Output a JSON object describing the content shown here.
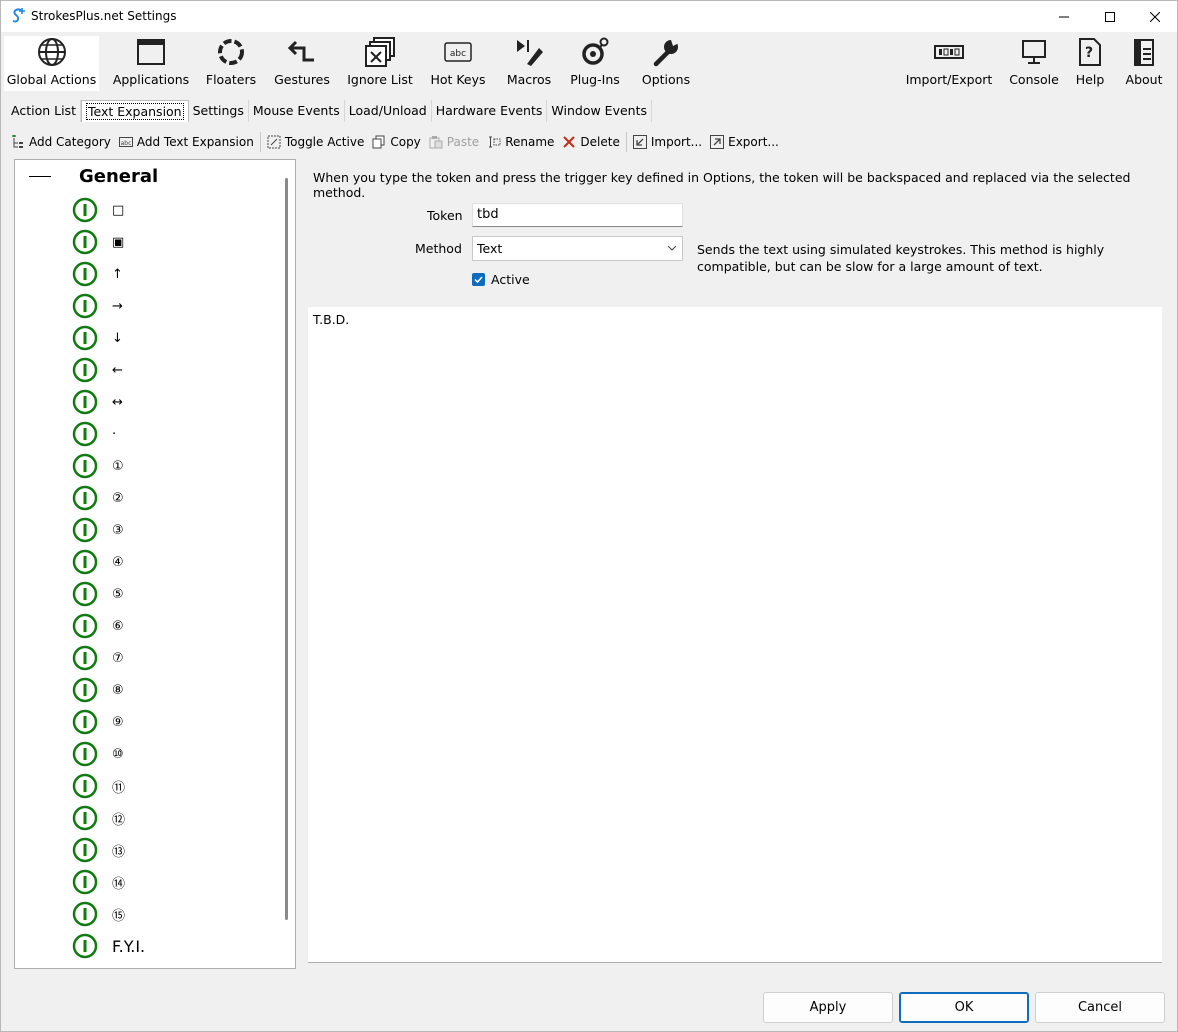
{
  "window": {
    "title": "StrokesPlus.net Settings"
  },
  "ribbon": {
    "items": [
      {
        "label": "Global Actions",
        "icon": "globe-icon"
      },
      {
        "label": "Applications",
        "icon": "window-icon"
      },
      {
        "label": "Floaters",
        "icon": "floaters-icon"
      },
      {
        "label": "Gestures",
        "icon": "gestures-icon"
      },
      {
        "label": "Ignore List",
        "icon": "ignore-list-icon"
      },
      {
        "label": "Hot Keys",
        "icon": "hot-keys-icon"
      },
      {
        "label": "Macros",
        "icon": "macros-icon"
      },
      {
        "label": "Plug-Ins",
        "icon": "plug-ins-icon"
      },
      {
        "label": "Options",
        "icon": "wrench-icon"
      },
      {
        "label": "Import/Export",
        "icon": "import-export-icon"
      },
      {
        "label": "Console",
        "icon": "monitor-icon"
      },
      {
        "label": "Help",
        "icon": "help-icon"
      },
      {
        "label": "About",
        "icon": "about-icon"
      }
    ]
  },
  "tabs": [
    "Action List",
    "Text Expansion",
    "Settings",
    "Mouse Events",
    "Load/Unload",
    "Hardware Events",
    "Window Events"
  ],
  "toolbar": {
    "add_category": "Add Category",
    "add_text_expansion": "Add Text Expansion",
    "toggle_active": "Toggle Active",
    "copy": "Copy",
    "paste": "Paste",
    "rename": "Rename",
    "delete": "Delete",
    "import": "Import...",
    "export": "Export..."
  },
  "tree": {
    "category": "General",
    "items": [
      "□",
      "▣",
      "↑",
      "→",
      "↓",
      "←",
      "↔",
      "·",
      "①",
      "②",
      "③",
      "④",
      "⑤",
      "⑥",
      "⑦",
      "⑧",
      "⑨",
      "⑩",
      "⑪",
      "⑫",
      "⑬",
      "⑭",
      "⑮",
      "F.Y.I."
    ]
  },
  "detail": {
    "description": "When you type the token and press the trigger key defined in Options, the token will be backspaced and replaced via the selected method.",
    "token_label": "Token",
    "token_value": "tbd",
    "method_label": "Method",
    "method_value": "Text",
    "method_description": "Sends the text using simulated keystrokes. This method is highly compatible, but can be slow for a large amount of text.",
    "active_label": "Active",
    "active": true,
    "expansion_text": "T.B.D."
  },
  "footer": {
    "apply": "Apply",
    "ok": "OK",
    "cancel": "Cancel"
  },
  "colors": {
    "active_green": "#107c10",
    "accent_blue": "#0f6cbd",
    "delete_red": "#c42b1c"
  }
}
